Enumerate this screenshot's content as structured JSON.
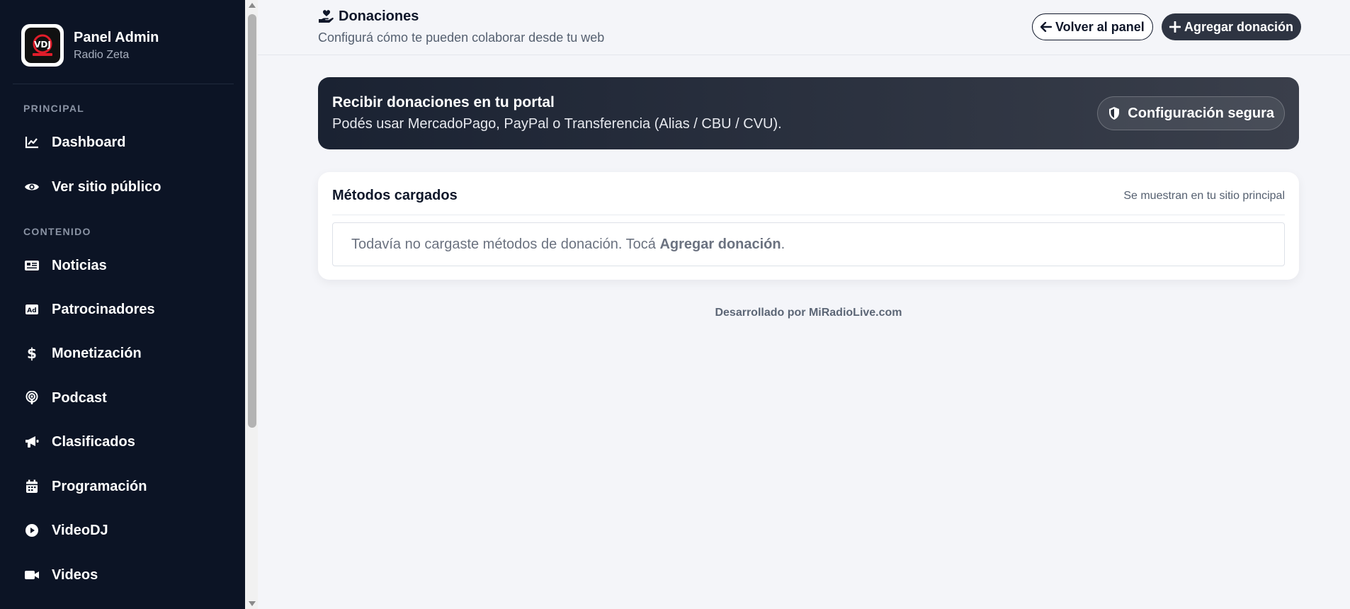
{
  "sidebar": {
    "brand_title": "Panel Admin",
    "brand_subtitle": "Radio Zeta",
    "logo_text": "VDJ",
    "sections": [
      {
        "label": "PRINCIPAL"
      },
      {
        "label": "CONTENIDO"
      }
    ],
    "items": [
      {
        "label": "Dashboard",
        "icon": "chart-line-icon"
      },
      {
        "label": "Ver sitio público",
        "icon": "eye-icon"
      },
      {
        "label": "Noticias",
        "icon": "newspaper-icon"
      },
      {
        "label": "Patrocinadores",
        "icon": "ad-icon"
      },
      {
        "label": "Monetización",
        "icon": "dollar-icon"
      },
      {
        "label": "Podcast",
        "icon": "podcast-icon"
      },
      {
        "label": "Clasificados",
        "icon": "bullhorn-icon"
      },
      {
        "label": "Programación",
        "icon": "calendar-icon"
      },
      {
        "label": "VideoDJ",
        "icon": "play-circle-icon"
      },
      {
        "label": "Videos",
        "icon": "video-camera-icon"
      }
    ]
  },
  "header": {
    "title": "Donaciones",
    "title_icon": "hand-holding-heart-icon",
    "subtitle": "Configurá cómo te pueden colaborar desde tu web",
    "back_label": "Volver al panel",
    "add_label": "Agregar donación"
  },
  "banner": {
    "title": "Recibir donaciones en tu portal",
    "text": "Podés usar MercadoPago, PayPal o Transferencia (Alias / CBU / CVU).",
    "secure_label": "Configuración segura"
  },
  "methods": {
    "title": "Métodos cargados",
    "hint": "Se muestran en tu sitio principal",
    "empty_prefix": "Todavía no cargaste métodos de donación. Tocá ",
    "empty_action": "Agregar donación",
    "empty_suffix": "."
  },
  "footer": {
    "text": "Desarrollado por MiRadioLive.com"
  },
  "colors": {
    "sidebar_bg": "#0c1425",
    "page_bg": "#f4f5f9",
    "banner_start": "#1a2232",
    "banner_end": "#3a3f4b",
    "dark_button": "#2e3442"
  }
}
